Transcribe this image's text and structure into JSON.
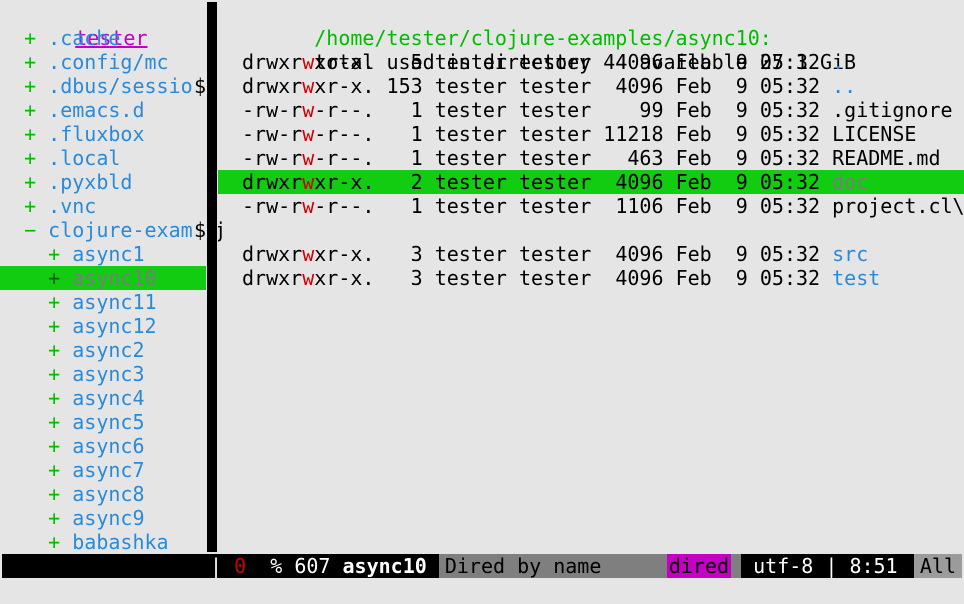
{
  "tree": {
    "root": "tester",
    "items": [
      {
        "prefix": "  + ",
        "name": ".cache",
        "trunc": false
      },
      {
        "prefix": "  + ",
        "name": ".config/mc",
        "trunc": false
      },
      {
        "prefix": "  + ",
        "name": ".dbus/sessio",
        "trunc": true
      },
      {
        "prefix": "  + ",
        "name": ".emacs.d",
        "trunc": false
      },
      {
        "prefix": "  + ",
        "name": ".fluxbox",
        "trunc": false
      },
      {
        "prefix": "  + ",
        "name": ".local",
        "trunc": false
      },
      {
        "prefix": "  + ",
        "name": ".pyxbld",
        "trunc": false
      },
      {
        "prefix": "  + ",
        "name": ".vnc",
        "trunc": false
      },
      {
        "prefix": "  − ",
        "name": "clojure-exam",
        "trunc": true
      },
      {
        "prefix": "    + ",
        "name": "async1",
        "trunc": false
      },
      {
        "prefix": "    + ",
        "name": "async10",
        "trunc": false,
        "selected": true
      },
      {
        "prefix": "    + ",
        "name": "async11",
        "trunc": false
      },
      {
        "prefix": "    + ",
        "name": "async12",
        "trunc": false
      },
      {
        "prefix": "    + ",
        "name": "async2",
        "trunc": false
      },
      {
        "prefix": "    + ",
        "name": "async3",
        "trunc": false
      },
      {
        "prefix": "    + ",
        "name": "async4",
        "trunc": false
      },
      {
        "prefix": "    + ",
        "name": "async5",
        "trunc": false
      },
      {
        "prefix": "    + ",
        "name": "async6",
        "trunc": false
      },
      {
        "prefix": "    + ",
        "name": "async7",
        "trunc": false
      },
      {
        "prefix": "    + ",
        "name": "async8",
        "trunc": false
      },
      {
        "prefix": "    + ",
        "name": "async9",
        "trunc": false
      },
      {
        "prefix": "    + ",
        "name": "babashka",
        "trunc": false
      }
    ],
    "trunc_marker": "$"
  },
  "dired": {
    "path": "/home/tester/clojure-examples/async10:",
    "summary": "total used in directory 44 available 27.1 GiB",
    "entries": [
      {
        "perm_a": "drwxr",
        "perm_w": "w",
        "perm_b": "xr-x.",
        "links": "  5",
        "owner": "tester",
        "group": "tester",
        "size": " 4096",
        "month": "Feb",
        "day": " 9",
        "time": "05:32",
        "name": ".",
        "dir": true
      },
      {
        "perm_a": "drwxr",
        "perm_w": "w",
        "perm_b": "xr-x.",
        "links": "153",
        "owner": "tester",
        "group": "tester",
        "size": " 4096",
        "month": "Feb",
        "day": " 9",
        "time": "05:32",
        "name": "..",
        "dir": true
      },
      {
        "perm_a": "-rw-r",
        "perm_w": "w",
        "perm_b": "-r--.",
        "links": "  1",
        "owner": "tester",
        "group": "tester",
        "size": "   99",
        "month": "Feb",
        "day": " 9",
        "time": "05:32",
        "name": ".gitignore",
        "dir": false
      },
      {
        "perm_a": "-rw-r",
        "perm_w": "w",
        "perm_b": "-r--.",
        "links": "  1",
        "owner": "tester",
        "group": "tester",
        "size": "11218",
        "month": "Feb",
        "day": " 9",
        "time": "05:32",
        "name": "LICENSE",
        "dir": false
      },
      {
        "perm_a": "-rw-r",
        "perm_w": "w",
        "perm_b": "-r--.",
        "links": "  1",
        "owner": "tester",
        "group": "tester",
        "size": "  463",
        "month": "Feb",
        "day": " 9",
        "time": "05:32",
        "name": "README.md",
        "dir": false
      },
      {
        "perm_a": "drwxr",
        "perm_w": "w",
        "perm_b": "xr-x.",
        "links": "  2",
        "owner": "tester",
        "group": "tester",
        "size": " 4096",
        "month": "Feb",
        "day": " 9",
        "time": "05:32",
        "name": "doc",
        "dir": true,
        "selected": true
      },
      {
        "perm_a": "-rw-r",
        "perm_w": "w",
        "perm_b": "-r--.",
        "links": "  1",
        "owner": "tester",
        "group": "tester",
        "size": " 1106",
        "month": "Feb",
        "day": " 9",
        "time": "05:32",
        "name": "project.cl\\",
        "dir": false,
        "wrap": "j"
      },
      {
        "perm_a": "drwxr",
        "perm_w": "w",
        "perm_b": "xr-x.",
        "links": "  3",
        "owner": "tester",
        "group": "tester",
        "size": " 4096",
        "month": "Feb",
        "day": " 9",
        "time": "05:32",
        "name": "src",
        "dir": true
      },
      {
        "perm_a": "drwxr",
        "perm_w": "w",
        "perm_b": "xr-x.",
        "links": "  3",
        "owner": "tester",
        "group": "tester",
        "size": " 4096",
        "month": "Feb",
        "day": " 9",
        "time": "05:32",
        "name": "test",
        "dir": true
      }
    ]
  },
  "modeline": {
    "bar": "|",
    "modified": "0",
    "percent_pos": "% 607",
    "buffer": "async10",
    "mode": "Dired by name",
    "dired_tag": "dired",
    "encoding": "utf-8 | 8:51",
    "position": "All"
  },
  "colors": {
    "selection": "#11cc11",
    "directory": "#2a8ad9",
    "tree_marker": "#00bb00",
    "root": "#c400c4",
    "perm_w": "#cc0000"
  }
}
